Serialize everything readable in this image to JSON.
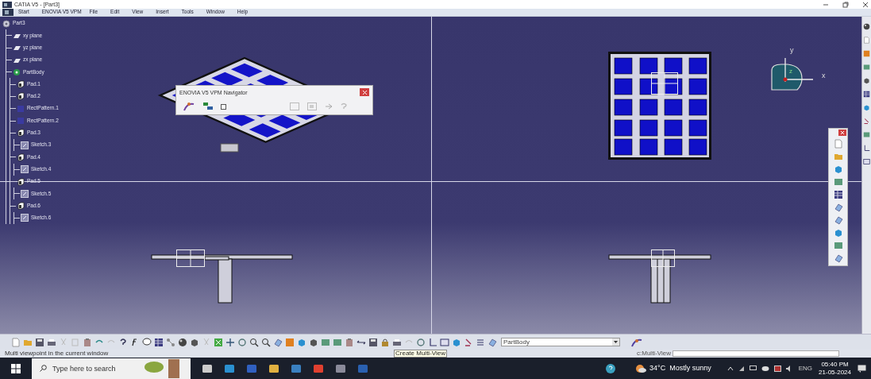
{
  "window": {
    "title": "CATIA V5 - [Part3]"
  },
  "menu": [
    "Start",
    "ENOVIA V5 VPM",
    "File",
    "Edit",
    "View",
    "Insert",
    "Tools",
    "Window",
    "Help"
  ],
  "tree": {
    "label": "Part3",
    "kind": "part",
    "children": [
      {
        "label": "xy plane",
        "kind": "plane"
      },
      {
        "label": "yz plane",
        "kind": "plane"
      },
      {
        "label": "zx plane",
        "kind": "plane"
      },
      {
        "label": "PartBody",
        "kind": "body",
        "children": [
          {
            "label": "Pad.1",
            "kind": "pad"
          },
          {
            "label": "Pad.2",
            "kind": "pad"
          },
          {
            "label": "RectPattern.1",
            "kind": "pattern"
          },
          {
            "label": "RectPattern.2",
            "kind": "pattern"
          },
          {
            "label": "Pad.3",
            "kind": "pad",
            "children": [
              {
                "label": "Sketch.3",
                "kind": "sketch"
              }
            ]
          },
          {
            "label": "Pad.4",
            "kind": "pad",
            "children": [
              {
                "label": "Sketch.4",
                "kind": "sketch"
              }
            ]
          },
          {
            "label": "Pad.5",
            "kind": "pad",
            "children": [
              {
                "label": "Sketch.5",
                "kind": "sketch"
              }
            ]
          },
          {
            "label": "Pad.6",
            "kind": "pad",
            "children": [
              {
                "label": "Sketch.6",
                "kind": "sketch"
              }
            ]
          }
        ]
      }
    ]
  },
  "navigator_dialog": {
    "title": "ENOVIA V5 VPM Navigator"
  },
  "compass": {
    "x_label": "x",
    "y_label": "y",
    "z_label": "z"
  },
  "toolbar": {
    "combo_value": "PartBody"
  },
  "status_bar": {
    "message": "Multi viewpoint in the current window",
    "tooltip": "Create Multi-View",
    "command": "c:Multi-View"
  },
  "taskbar": {
    "search_placeholder": "Type here to search",
    "weather": "34°C  Mostly sunny",
    "language": "ENG",
    "time": "05:40 PM",
    "date": "21-05-2024"
  }
}
